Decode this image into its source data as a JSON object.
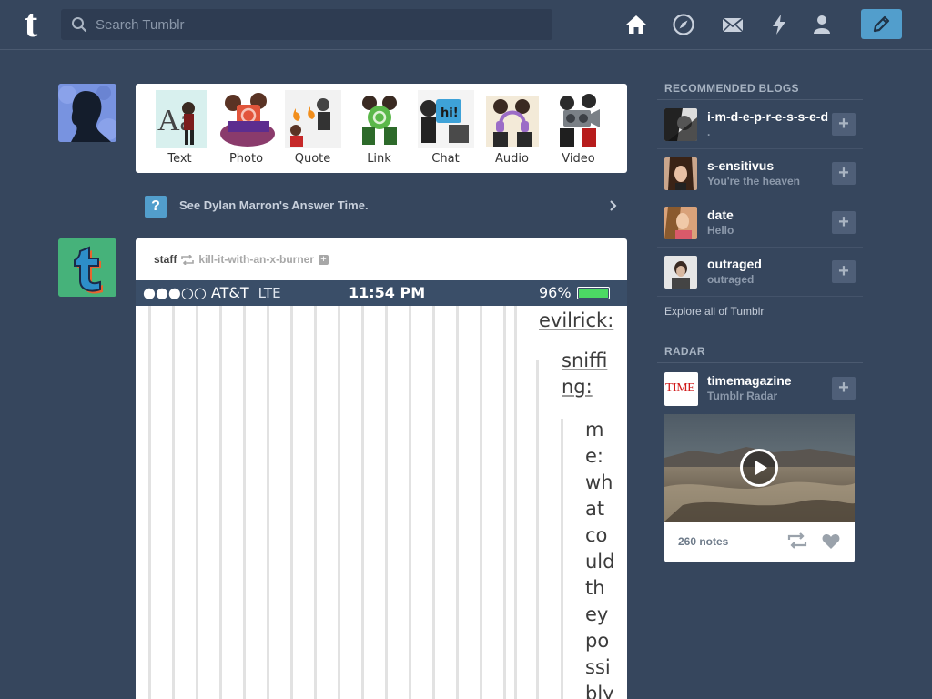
{
  "header": {
    "logo": "t",
    "search_placeholder": "Search Tumblr"
  },
  "post_types": [
    {
      "label": "Text",
      "icon": "Aa"
    },
    {
      "label": "Photo",
      "icon": "camera"
    },
    {
      "label": "Quote",
      "icon": "quote"
    },
    {
      "label": "Link",
      "icon": "link"
    },
    {
      "label": "Chat",
      "icon": "hi!"
    },
    {
      "label": "Audio",
      "icon": "headphones"
    },
    {
      "label": "Video",
      "icon": "video-camera"
    }
  ],
  "answer_time": {
    "icon": "?",
    "text": "See Dylan Marron's Answer Time."
  },
  "post": {
    "author": "staff",
    "reblogged_from": "kill-it-with-an-x-burner",
    "follow_plus": "+",
    "statusbar": {
      "carrier": "●●●○○ AT&T",
      "network": "LTE",
      "time": "11:54 PM",
      "battery": "96%"
    },
    "thread": {
      "user1": "evilrick:",
      "user2_line1": "sniffi",
      "user2_line2": "ng:",
      "reply_lines": [
        "m",
        "e:",
        "wh",
        "at",
        "co",
        "uld",
        "th",
        "ey",
        "po",
        "ssi",
        "bly"
      ]
    }
  },
  "sidebar": {
    "recommended_title": "RECOMMENDED BLOGS",
    "blogs": [
      {
        "name": "i-m-d-e-p-r-e-s-s-e-d",
        "sub": "."
      },
      {
        "name": "s-ensitivus",
        "sub": "You're the heaven"
      },
      {
        "name": "date",
        "sub": "Hello"
      },
      {
        "name": "outraged",
        "sub": "outraged"
      }
    ],
    "explore_link": "Explore all of Tumblr",
    "radar_title": "RADAR",
    "radar": {
      "name": "timemagazine",
      "sub": "Tumblr Radar",
      "logo_text": "TIME",
      "notes": "260 notes"
    }
  },
  "colors": {
    "background": "#36465d",
    "accent": "#529ecc",
    "battery": "#4cd964"
  }
}
